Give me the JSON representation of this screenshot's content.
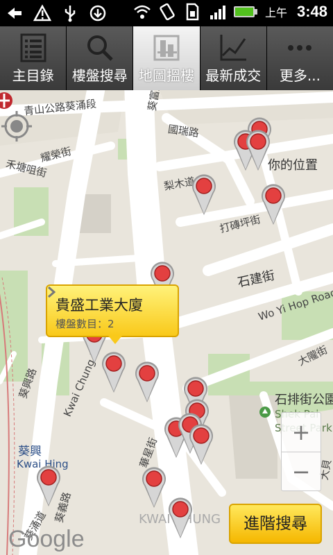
{
  "status_bar": {
    "ampm": "上午",
    "time": "3:48"
  },
  "tabs": [
    {
      "label": "主目錄",
      "icon": "list-icon",
      "active": false
    },
    {
      "label": "樓盤搜尋",
      "icon": "search-icon",
      "active": false
    },
    {
      "label": "地圖搵樓",
      "icon": "map-building-icon",
      "active": true
    },
    {
      "label": "最新成交",
      "icon": "line-chart-icon",
      "active": false
    },
    {
      "label": "更多...",
      "icon": "more-icon",
      "active": false
    }
  ],
  "map": {
    "street_labels": {
      "qingshan": "青山公路葵涌段",
      "kwai_fung": "葵富路",
      "kwok_shui": "國瑞路",
      "yiu_wing": "耀榮街",
      "wo_tong_tsui": "禾塘咀街",
      "lei_muk": "梨木道",
      "tai_pak": "打磚坪街",
      "shek_kin": "石建街",
      "wo_yi_hop": "Wo Yi Hop Road",
      "tai_loong": "大隴街",
      "kwai_chung_rd": "Kwai Chung Rd",
      "kwai_hing_rd": "葵興路",
      "kwai_yi": "葵義路",
      "kwai_chung_rd_zh": "葵涌道",
      "wah_sing": "華星街",
      "kwai_chung_area": "KWAI CHUNG",
      "shek_pai_park_zh": "石排街公園",
      "shek_pai_park_en1": "Shek Pai",
      "shek_pai_park_en2": "Street Park",
      "your_location": "你的位置",
      "tai_pui": "大貝"
    },
    "mtr_station_zh": "葵興",
    "mtr_station_en": "Kwai Hing",
    "callout": {
      "title": "貴盛工業大廈",
      "subtitle": "樓盤數目：2"
    },
    "advanced_search": "進階搜尋",
    "google": "Google",
    "zoom_in": "+",
    "zoom_out": "−"
  },
  "colors": {
    "pin": "#e34040",
    "callout": "#fbd83a",
    "map_bg": "#e9e5dc"
  }
}
